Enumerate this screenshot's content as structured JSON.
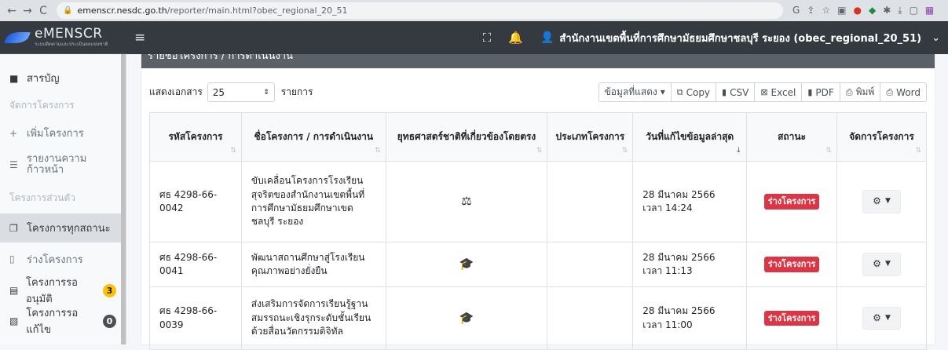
{
  "browser": {
    "url_host": "emenscr.nesdc.go.th",
    "url_path": "/reporter/main.html?obec_regional_20_51"
  },
  "navbar": {
    "brand_name": "eMENSCR",
    "brand_sub": "ระบบติดตามและประเมินผลแห่งชาติ",
    "user": "สำนักงานเขตพื้นที่การศึกษามัธยมศึกษาชลบุรี ระยอง (obec_regional_20_51)"
  },
  "sidebar": {
    "toc": "สารบัญ",
    "section_manage": "จัดการโครงการ",
    "add_project": "เพิ่มโครงการ",
    "progress_report": "รายงานความก้าวหน้า",
    "section_personal": "โครงการส่วนตัว",
    "all_projects": "โครงการทุกสถานะ",
    "draft_projects": "ร่างโครงการ",
    "pending_approval": "โครงการรออนุมัติ",
    "pending_approval_count": "3",
    "pending_fix": "โครงการรอแก้ไข",
    "pending_fix_count": "0"
  },
  "card": {
    "header": "รายชื่อโครงการ / การดำเนินงาน"
  },
  "toolbar": {
    "show_label": "แสดงเอกสาร",
    "page_length": "25",
    "unit": "รายการ",
    "buttons": [
      "ข้อมูลที่แสดง ▾",
      "Copy",
      "CSV",
      "Excel",
      "PDF",
      "พิมพ์",
      "Word"
    ]
  },
  "table": {
    "headers": [
      "รหัสโครงการ",
      "ชื่อโครงการ / การดำเนินงาน",
      "ยุทธศาสตร์ชาติที่เกี่ยวข้องโดยตรง",
      "ประเภทโครงการ",
      "วันที่แก้ไขข้อมูลล่าสุด",
      "สถานะ",
      "จัดการโครงการ"
    ],
    "rows": [
      {
        "code": "ศธ 4298-66-0042",
        "name": "ขับเคลื่อนโครงการโรงเรียนสุจริตของสำนักงานเขตพื้นที่การศึกษามัธยมศึกษาเขตชลบุรี ระยอง",
        "strategy_icon": "balance-scale-icon",
        "type": "",
        "date": "28 มีนาคม 2566",
        "time": "เวลา 14:24",
        "status": "ร่างโครงการ"
      },
      {
        "code": "ศธ 4298-66-0041",
        "name": "พัฒนาสถานศึกษาสู่โรงเรียนคุณภาพอย่างยั่งยืน",
        "strategy_icon": "graduation-cap-icon",
        "type": "",
        "date": "28 มีนาคม 2566",
        "time": "เวลา 11:13",
        "status": "ร่างโครงการ"
      },
      {
        "code": "ศธ 4298-66-0039",
        "name": "ส่งเสริมการจัดการเรียนรู้ฐานสมรรถนะเชิงรุกระดับชั้นเรียนด้วยสื่อนวัตกรรมดิจิทัล",
        "strategy_icon": "graduation-cap-icon",
        "type": "",
        "date": "28 มีนาคม 2566",
        "time": "เวลา 11:00",
        "status": "ร่างโครงการ"
      }
    ]
  }
}
